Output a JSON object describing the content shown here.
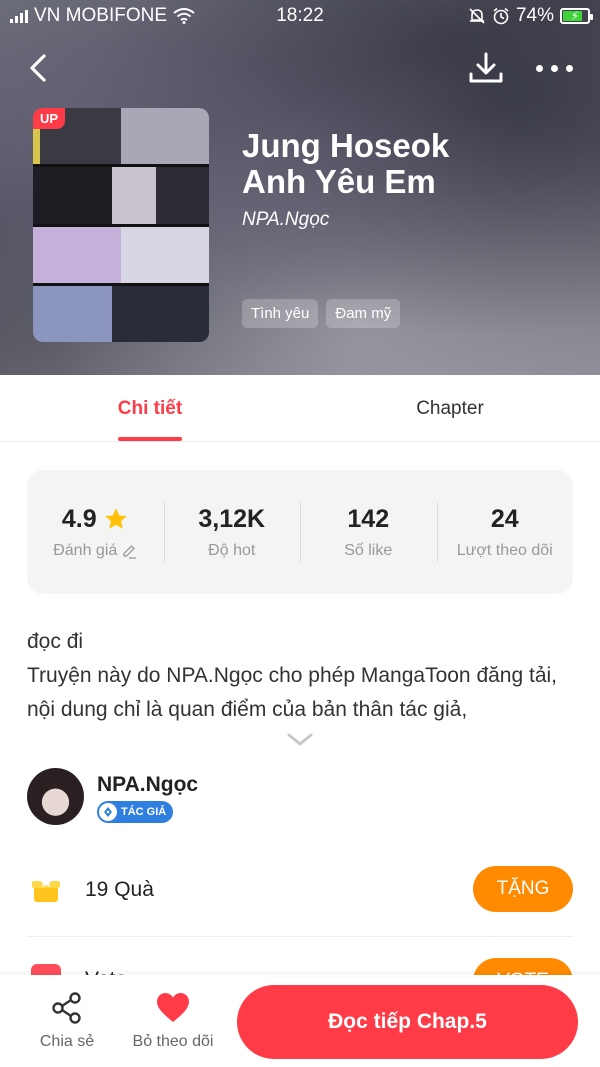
{
  "status_bar": {
    "carrier": "VN MOBIFONE",
    "time": "18:22",
    "battery": "74%",
    "battery_level": 0.74
  },
  "header": {
    "back_icon": "chevron-left-icon",
    "download_icon": "download-icon",
    "more_icon": "more-dots-icon"
  },
  "comic": {
    "badge": "UP",
    "title_line1": "Jung Hoseok",
    "title_line2": "Anh Yêu Em",
    "author": "NPA.Ngọc",
    "tags": [
      "Tình yêu",
      "Đam mỹ"
    ]
  },
  "tabs": [
    {
      "label": "Chi tiết",
      "active": true
    },
    {
      "label": "Chapter",
      "active": false
    }
  ],
  "stats": [
    {
      "value": "4.9",
      "label": "Đánh giá"
    },
    {
      "value": "3,12K",
      "label": "Độ hot"
    },
    {
      "value": "142",
      "label": "Số like"
    },
    {
      "value": "24",
      "label": "Lượt theo dõi"
    }
  ],
  "description": {
    "line1": "đọc đi",
    "line2": "Truyện này do NPA.Ngọc cho phép MangaToon đăng tải, nội dung chỉ là quan điểm của bản thân tác giả,"
  },
  "author_section": {
    "name": "NPA.Ngọc",
    "badge": "TÁC GIẢ"
  },
  "gift": {
    "count_text": "19  Quà",
    "button": "TẶNG"
  },
  "vote": {
    "text": "Vote ……… ……",
    "button": "VOTE"
  },
  "bottom_bar": {
    "share_label": "Chia sẻ",
    "unfollow_label": "Bỏ theo dõi",
    "read_button": "Đọc tiếp Chap.5"
  },
  "colors": {
    "accent": "#ff3b48",
    "orange": "#ff8a00",
    "star": "#ffc107",
    "badge_blue": "#2f7fe0"
  }
}
